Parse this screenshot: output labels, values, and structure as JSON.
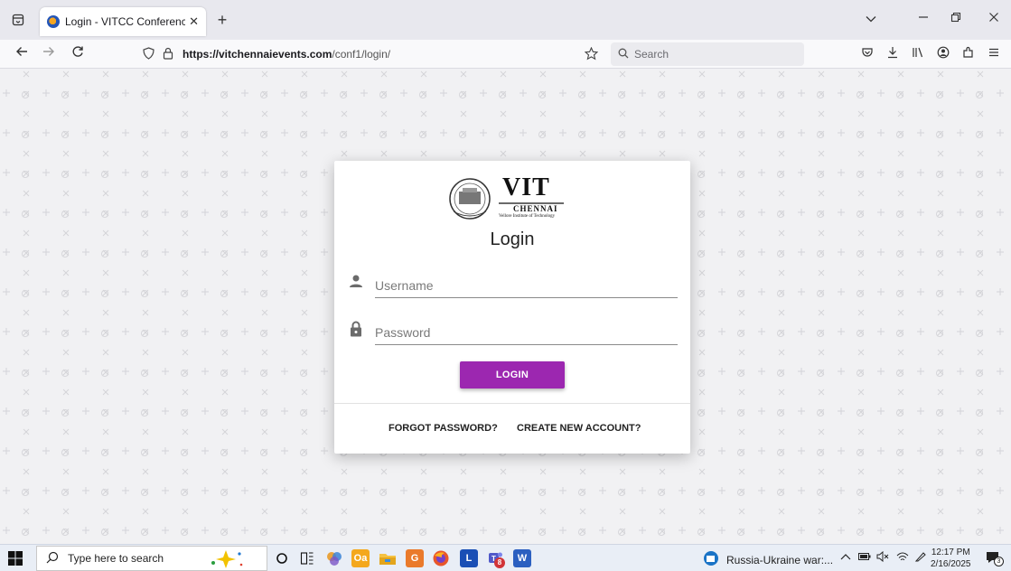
{
  "browser": {
    "tab_title": "Login - VITCC Conferences & W",
    "tab_close": "✕",
    "new_tab": "+",
    "url_host": "https://vitchennaievents.com",
    "url_path": "/conf1/login/",
    "search_placeholder": "Search"
  },
  "logo": {
    "brand": "VIT",
    "city": "CHENNAI",
    "tagline": "Vellore Institute of Technology"
  },
  "login": {
    "title": "Login",
    "username_placeholder": "Username",
    "password_placeholder": "Password",
    "login_button": "LOGIN",
    "forgot_password": "FORGOT PASSWORD?",
    "create_account": "CREATE NEW ACCOUNT?"
  },
  "colors": {
    "accent": "#9c27b0"
  },
  "taskbar": {
    "search_placeholder": "Type here to search",
    "news_text": "Russia-Ukraine war:...",
    "time": "12:17 PM",
    "date": "2/16/2025",
    "teams_badge": "8",
    "notification_count": "3"
  }
}
